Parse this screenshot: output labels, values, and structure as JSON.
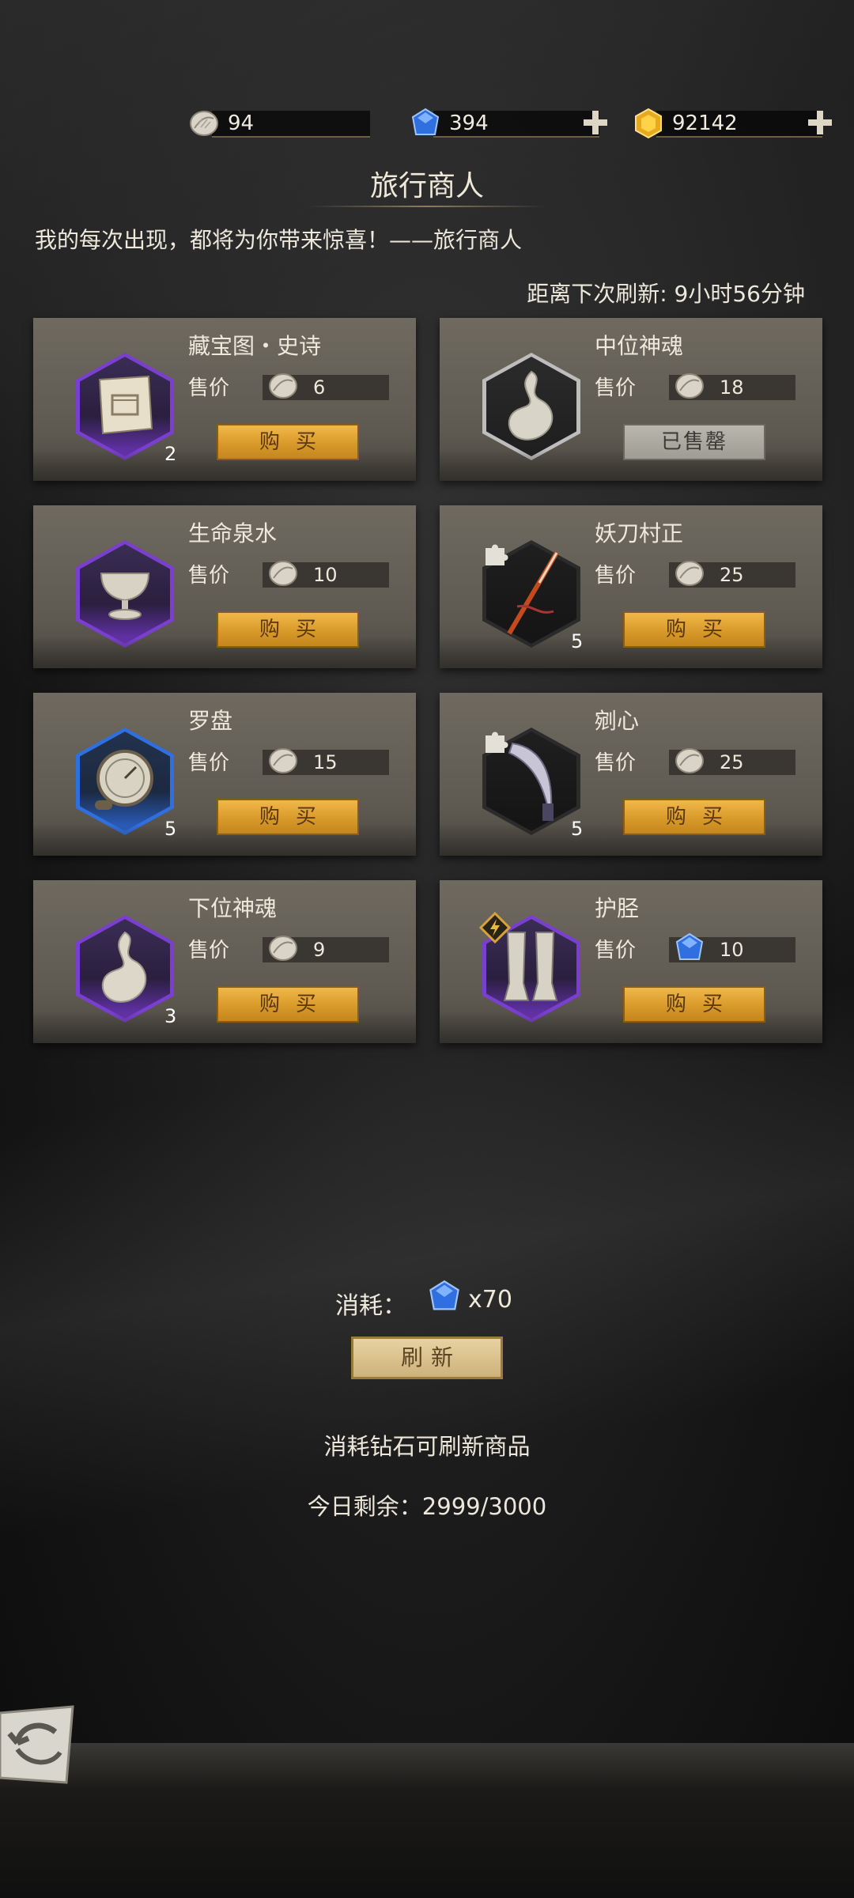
{
  "currencies": [
    {
      "icon": "leaf-coin-icon",
      "value": "94",
      "has_plus": false
    },
    {
      "icon": "blue-diamond-icon",
      "value": "394",
      "has_plus": true
    },
    {
      "icon": "gold-gem-icon",
      "value": "92142",
      "has_plus": true
    }
  ],
  "shop": {
    "title": "旅行商人",
    "subtitle": "我的每次出现，都将为你带来惊喜！——旅行商人",
    "refresh_timer": "距离下次刷新: 9小时56分钟",
    "price_label": "售价",
    "buy_label": "购买",
    "sold_out_label": "已售罄"
  },
  "items": [
    {
      "name": "藏宝图・史诗",
      "price": "6",
      "currency": "leaf-coin-icon",
      "qty": "2",
      "status": "buy",
      "icon": "treasure-map-icon",
      "frame": "purple"
    },
    {
      "name": "中位神魂",
      "price": "18",
      "currency": "leaf-coin-icon",
      "qty": "",
      "status": "sold",
      "icon": "spirit-flame-icon",
      "frame": "silver"
    },
    {
      "name": "生命泉水",
      "price": "10",
      "currency": "leaf-coin-icon",
      "qty": "",
      "status": "buy",
      "icon": "chalice-icon",
      "frame": "purple"
    },
    {
      "name": "妖刀村正",
      "price": "25",
      "currency": "leaf-coin-icon",
      "qty": "5",
      "status": "buy",
      "icon": "katana-icon",
      "frame": "dark"
    },
    {
      "name": "罗盘",
      "price": "15",
      "currency": "leaf-coin-icon",
      "qty": "5",
      "status": "buy",
      "icon": "compass-icon",
      "frame": "blue"
    },
    {
      "name": "剜心",
      "price": "25",
      "currency": "leaf-coin-icon",
      "qty": "5",
      "status": "buy",
      "icon": "curved-blade-icon",
      "frame": "dark"
    },
    {
      "name": "下位神魂",
      "price": "9",
      "currency": "leaf-coin-icon",
      "qty": "3",
      "status": "buy",
      "icon": "spirit-flame-icon",
      "frame": "purple"
    },
    {
      "name": "护胫",
      "price": "10",
      "currency": "blue-diamond-icon",
      "qty": "",
      "status": "buy",
      "icon": "greaves-icon",
      "frame": "purple"
    }
  ],
  "refresh": {
    "cost_label": "消耗：",
    "cost_value": "x70",
    "button_label": "刷新",
    "hint": "消耗钻石可刷新商品",
    "remaining": "今日剩余：2999/3000"
  }
}
